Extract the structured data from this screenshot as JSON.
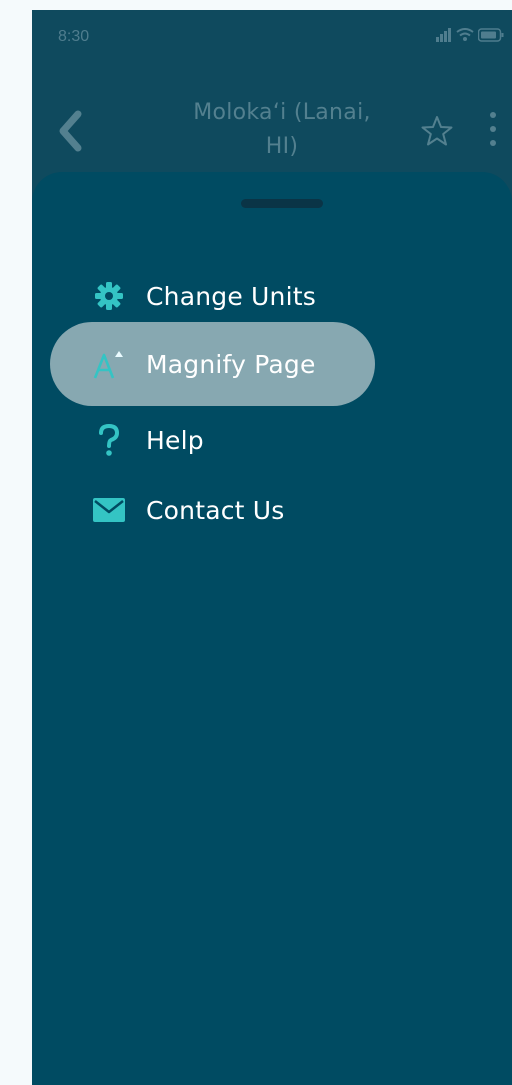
{
  "status_bar": {
    "time": "8:30"
  },
  "header": {
    "title": "Moloka‘i (Lanai,\nHI)"
  },
  "menu": {
    "items": [
      {
        "label": "Change Units",
        "icon": "gear-icon"
      },
      {
        "label": "Magnify Page",
        "icon": "text-size-icon",
        "highlighted": true
      },
      {
        "label": "Help",
        "icon": "question-icon"
      },
      {
        "label": "Contact Us",
        "icon": "envelope-icon"
      }
    ]
  },
  "colors": {
    "sheet_background": "#004b62",
    "highlight": "#87a8b1",
    "icon_accent": "#34c4c4"
  }
}
